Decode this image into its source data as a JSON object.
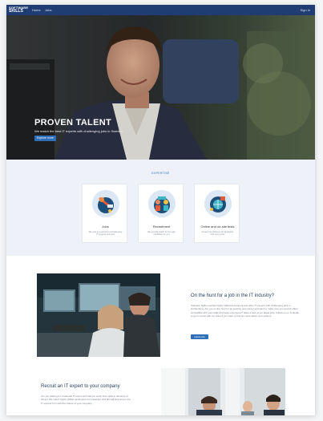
{
  "nav": {
    "logo_line1": "SOFTWARE",
    "logo_line2": "SKILLS",
    "links": [
      "Home",
      "Jobs"
    ],
    "signin": "Sign In"
  },
  "hero": {
    "title": "PROVEN TALENT",
    "subtitle": "We match the best IT experts with challenging jobs in Sweden.",
    "button": "Explore more"
  },
  "expertise": {
    "heading": "EXPERTISE",
    "cards": [
      {
        "title": "Jobs",
        "desc": "We post a curated list of challenging IT projects and jobs",
        "icon": "rocket-icon"
      },
      {
        "title": "Recruitment",
        "desc": "We provide match for the right candidate for you",
        "icon": "team-icon"
      },
      {
        "title": "Online and on-site tests",
        "desc": "Assess the skill level of candidates with every tests",
        "icon": "globe-icon"
      }
    ]
  },
  "hunt": {
    "title": "On the hunt for a job in the IT industry?",
    "text": "Software Skills matches highly skilled developers and other IT experts with challenging jobs in Gothenburg. Are you on the hunt for an exciting new career and want to make sure you get job offers compatible with your skills and work experience? Have a look at our latest jobs. Follow us on LinkedIn or get in touch with our team if you want to find out more about your options.",
    "button": "Latest jobs"
  },
  "recruit": {
    "title": "Recruit an IT expert to your company",
    "text": "Are you looking for a talented IT expert and want to verify their skills in advance of hiring? We match highly skilled developers from Sweden and abroad and ensure the IT experts fit in with the culture of your company."
  }
}
